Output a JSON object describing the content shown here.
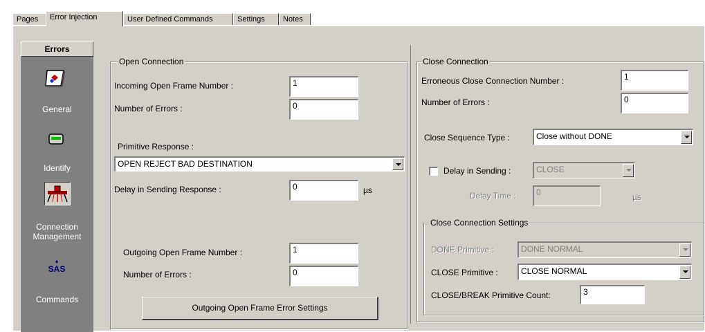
{
  "tabs": [
    "Pages",
    "Error Injection",
    "User Defined Commands",
    "Settings",
    "Notes"
  ],
  "sidebar": {
    "header": "Errors",
    "items": [
      {
        "label": "General",
        "icon": "general-icon"
      },
      {
        "label": "Identify",
        "icon": "identify-icon"
      },
      {
        "label": "Connection Management",
        "icon": "connection-management-icon"
      },
      {
        "label": "Commands",
        "icon": "sas-commands-icon",
        "icon_text": "SAS"
      }
    ]
  },
  "open_connection": {
    "title": "Open Connection",
    "incoming_label": "Incoming Open Frame Number :",
    "incoming_value": "1",
    "num_errors_label": "Number of Errors :",
    "num_errors_value": "0",
    "primitive_label": "Primitive Response :",
    "primitive_value": "OPEN REJECT BAD DESTINATION",
    "delay_label": "Delay in Sending Response :",
    "delay_value": "0",
    "delay_unit": "µs",
    "outgoing_label": "Outgoing Open Frame Number :",
    "outgoing_value": "1",
    "outgoing_errors_label": "Number of Errors :",
    "outgoing_errors_value": "0",
    "settings_button": "Outgoing Open Frame Error Settings"
  },
  "close_connection": {
    "title": "Close Connection",
    "erroneous_label": "Erroneous Close Connection Number :",
    "erroneous_value": "1",
    "num_errors_label": "Number of Errors :",
    "num_errors_value": "0",
    "sequence_label": "Close Sequence Type :",
    "sequence_value": "Close without DONE",
    "delay_check_label": "Delay in Sending :",
    "delay_combo_value": "CLOSE",
    "delay_time_label": "Delay Time :",
    "delay_time_value": "0",
    "delay_unit": "µs",
    "settings": {
      "title": "Close Connection Settings",
      "done_label": "DONE Primitive :",
      "done_value": "DONE NORMAL",
      "close_label": "CLOSE Primitive :",
      "close_value": "CLOSE NORMAL",
      "count_label": "CLOSE/BREAK Primitive Count:",
      "count_value": "3"
    }
  }
}
